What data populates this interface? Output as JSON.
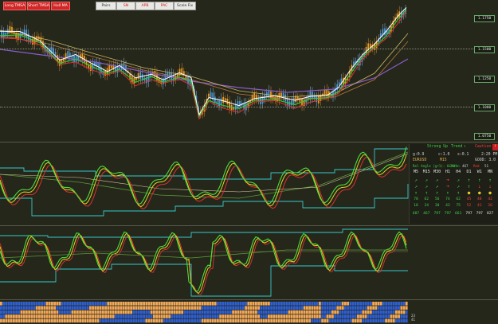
{
  "toolbar": {
    "buttons": [
      {
        "label": "Long TMSA",
        "style": "red"
      },
      {
        "label": "Short TMSA",
        "style": "red"
      },
      {
        "label": "Hull MA",
        "style": "red"
      },
      {
        "label": "Pairs",
        "style": "light"
      },
      {
        "label": "SN",
        "style": "light"
      },
      {
        "label": "APB",
        "style": "light"
      },
      {
        "label": "PAC",
        "style": "light"
      },
      {
        "label": "Scale Fix",
        "style": "light"
      }
    ]
  },
  "price_axis": {
    "labels": [
      "1.1750",
      "1.1500",
      "1.1250",
      "1.1000",
      "1.0750"
    ]
  },
  "colors": {
    "background": "#25271b",
    "up_candle": "#4a9ad8",
    "down_candle": "#e89a20",
    "ma_fast": "#ffffff",
    "ma_green": "#37c837",
    "ma_red": "#e03030",
    "ma_purple": "#8b5cc9",
    "osc_green": "#4ade3a",
    "osc_yellow": "#e8d020",
    "osc_red": "#e03030",
    "band_cyan": "#38c8c8",
    "bars_blue": "#2f5fd0",
    "bars_orange": "#f0a85a"
  },
  "panel": {
    "header": {
      "left": "Strong Up",
      "mid": "Trend",
      "right": "Caution"
    },
    "stats": {
      "g": "g:0.9",
      "c": "c:1.0",
      "s": "s:0.1",
      "time": "2:20 PM"
    },
    "pair_row": {
      "pair": "EURUSD",
      "tf": "M15",
      "status": "GOOD: 3.0"
    },
    "angle_row": {
      "label": "Rel Angle (gr1):",
      "value": "0.90°",
      "state1": "Green",
      "n1": "467",
      "state2": "Red",
      "n2": "51"
    },
    "timeframes": [
      "M5",
      "M15",
      "M30",
      "H1",
      "H4",
      "D1",
      "W1",
      "MN"
    ],
    "row_a": [
      "↗",
      "↗",
      "↗",
      "➜",
      "↗",
      "↑",
      "↑",
      "↑"
    ],
    "row_b": [
      "↗",
      "↗",
      "↗",
      "➜",
      "↗",
      "↑",
      "↓",
      "↓"
    ],
    "row_c": [
      "↑",
      "↑",
      "↑",
      "↑",
      "↑",
      "●",
      "●",
      "●"
    ],
    "row_d": [
      "78",
      "62",
      "56",
      "74",
      "62",
      "45",
      "48",
      "42"
    ],
    "row_e": [
      "18",
      "24",
      "30",
      "43",
      "75",
      "52",
      "41",
      "26"
    ],
    "row_f": [
      "687",
      "467",
      "797",
      "797",
      "661",
      "797",
      "797",
      "827"
    ]
  },
  "corner": {
    "line1": "23",
    "line2": "41"
  }
}
